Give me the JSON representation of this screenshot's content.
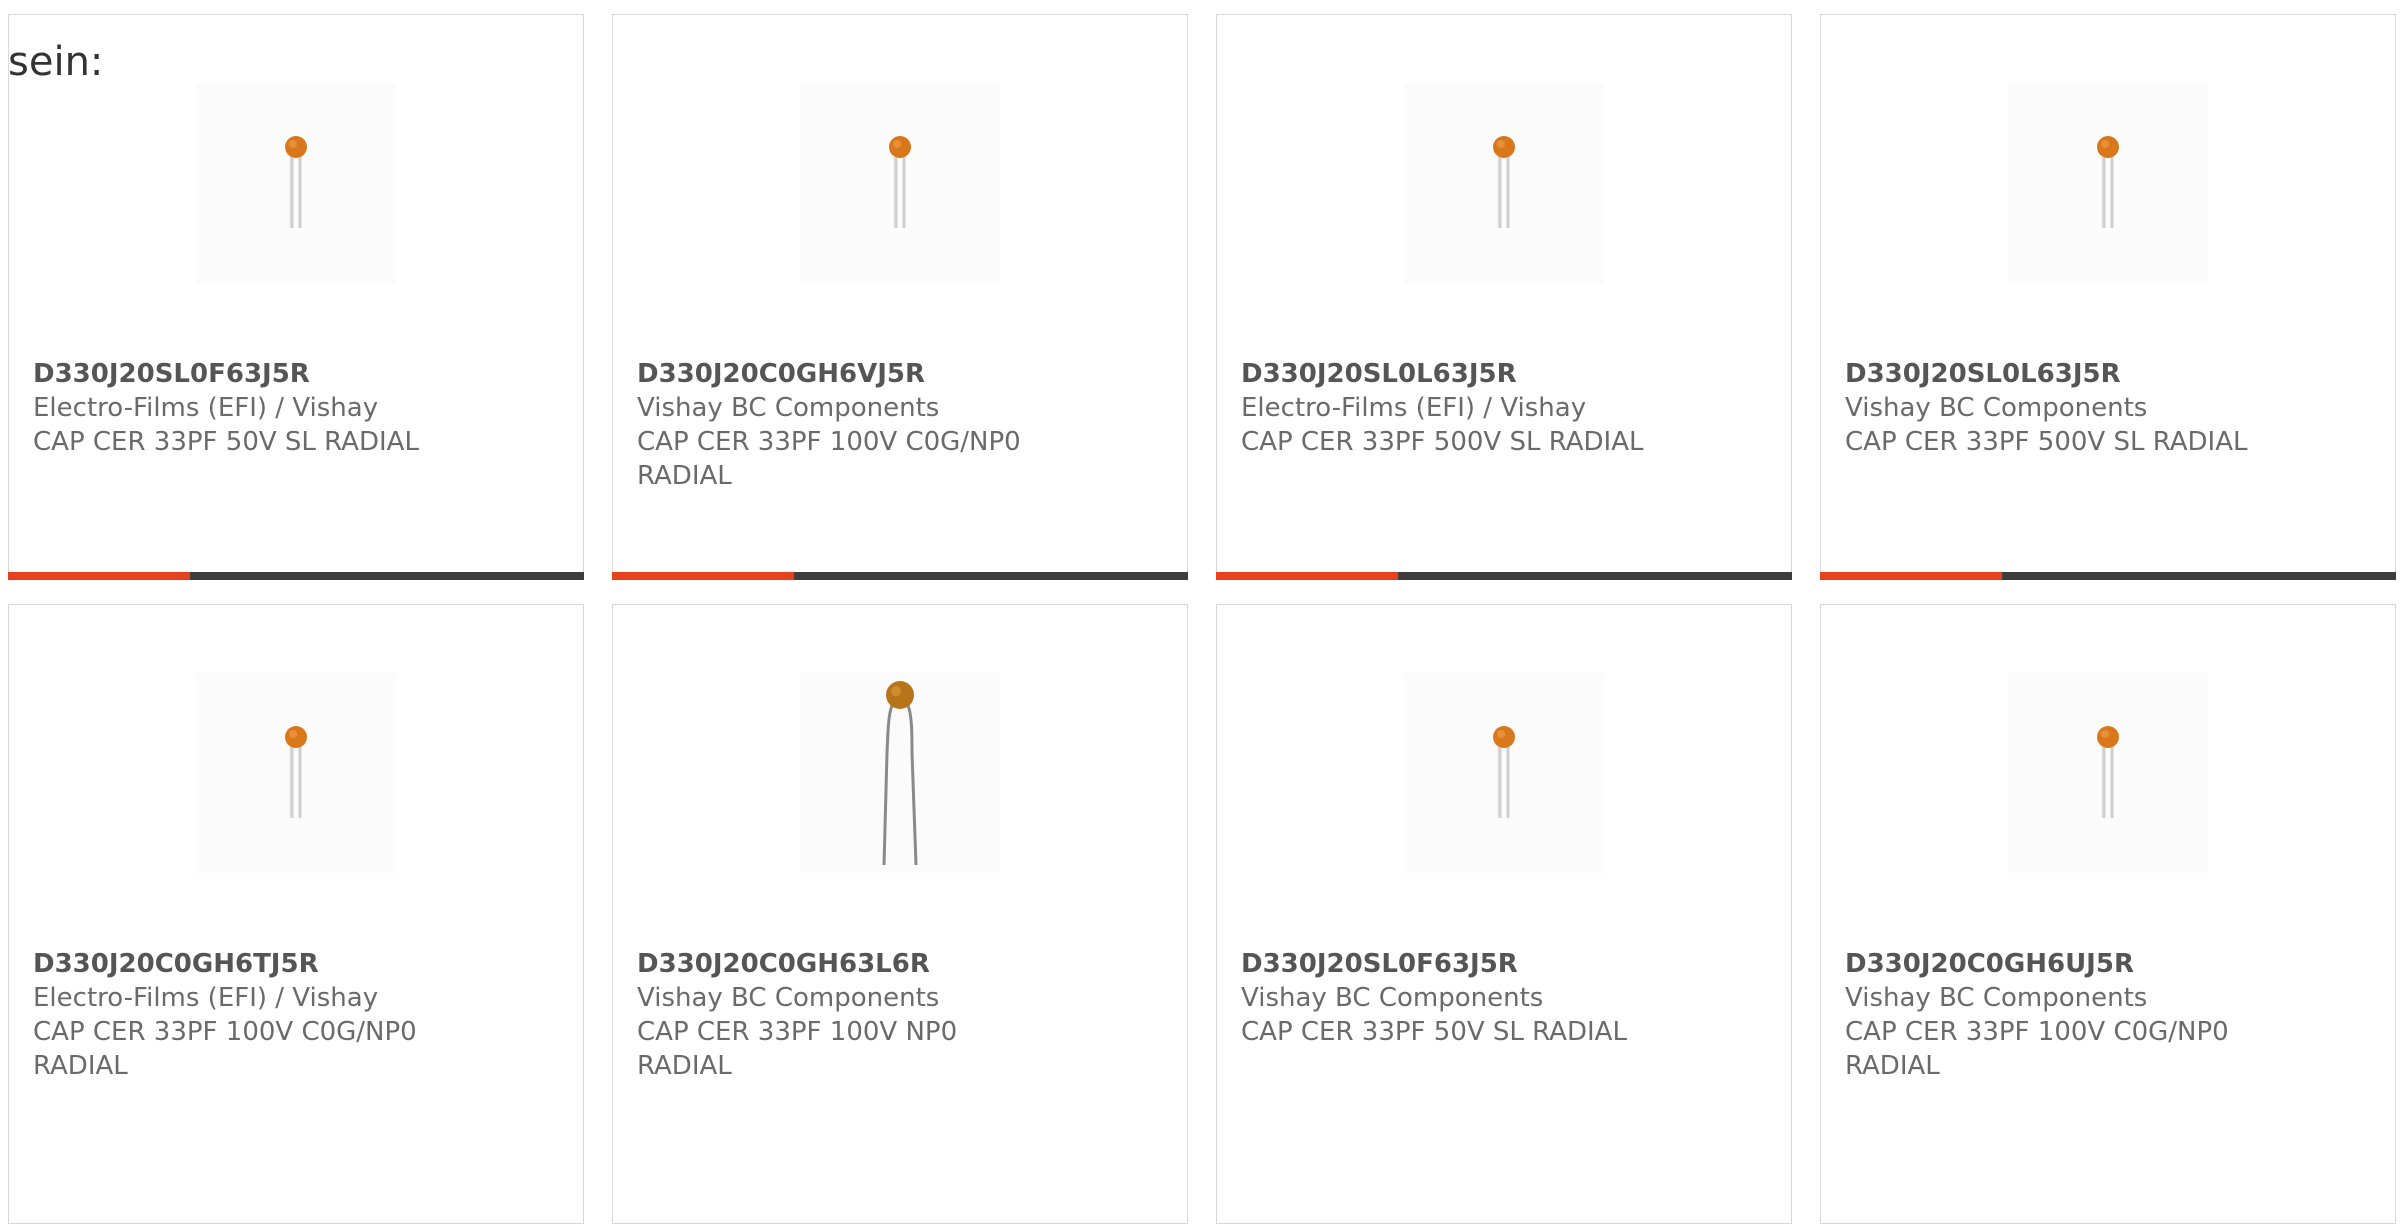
{
  "intro_text": "sein:",
  "colors": {
    "accent": "#e8411e",
    "bar_dark": "#3d3d3d",
    "capacitor_body": "#d9781a"
  },
  "products": [
    {
      "part": "D330J20SL0F63J5R",
      "manufacturer": "Electro-Films (EFI) / Vishay",
      "description": "CAP CER 33PF 50V SL RADIAL",
      "image": "ceramic-disc-capacitor-icon"
    },
    {
      "part": "D330J20C0GH6VJ5R",
      "manufacturer": "Vishay BC Components",
      "description": "CAP CER 33PF 100V C0G/NP0 RADIAL",
      "image": "ceramic-disc-capacitor-icon"
    },
    {
      "part": "D330J20SL0L63J5R",
      "manufacturer": "Electro-Films (EFI) / Vishay",
      "description": "CAP CER 33PF 500V SL RADIAL",
      "image": "ceramic-disc-capacitor-icon"
    },
    {
      "part": "D330J20SL0L63J5R",
      "manufacturer": "Vishay BC Components",
      "description": "CAP CER 33PF 500V SL RADIAL",
      "image": "ceramic-disc-capacitor-icon"
    },
    {
      "part": "D330J20C0GH6TJ5R",
      "manufacturer": "Electro-Films (EFI) / Vishay",
      "description": "CAP CER 33PF 100V C0G/NP0 RADIAL",
      "image": "ceramic-disc-capacitor-icon"
    },
    {
      "part": "D330J20C0GH63L6R",
      "manufacturer": "Vishay BC Components",
      "description": "CAP CER 33PF 100V NP0 RADIAL",
      "image": "ceramic-disc-capacitor-long-leads-icon"
    },
    {
      "part": "D330J20SL0F63J5R",
      "manufacturer": "Vishay BC Components",
      "description": "CAP CER 33PF 50V SL RADIAL",
      "image": "ceramic-disc-capacitor-icon"
    },
    {
      "part": "D330J20C0GH6UJ5R",
      "manufacturer": "Vishay BC Components",
      "description": "CAP CER 33PF 100V C0G/NP0 RADIAL",
      "image": "ceramic-disc-capacitor-icon"
    }
  ]
}
